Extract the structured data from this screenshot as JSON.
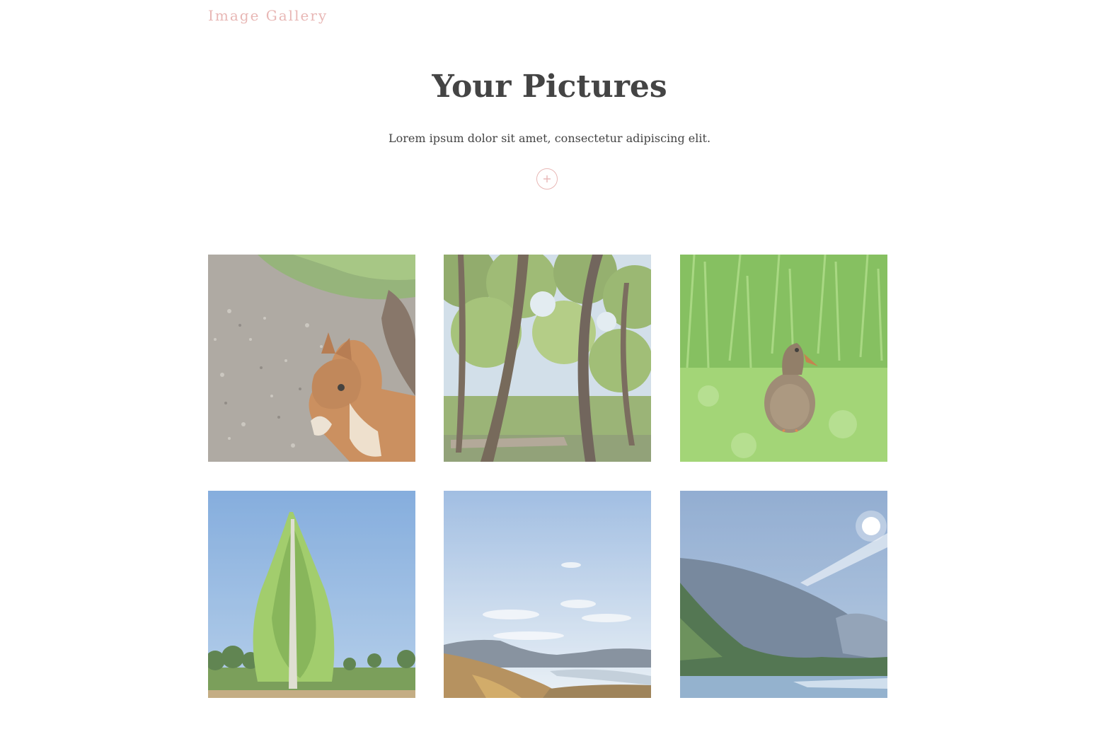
{
  "header": {
    "brand": "Image Gallery"
  },
  "hero": {
    "title": "Your Pictures",
    "subtitle": "Lorem ipsum dolor sit amet, consectetur adipiscing elit.",
    "add_icon": "plus-icon"
  },
  "gallery": {
    "items": [
      {
        "subject": "squirrel"
      },
      {
        "subject": "forest"
      },
      {
        "subject": "duck"
      },
      {
        "subject": "birch-tree"
      },
      {
        "subject": "mountain-sky"
      },
      {
        "subject": "mountain-lake"
      }
    ]
  },
  "colors": {
    "accent": "#e8b7b5",
    "text": "#444444",
    "background": "#ffffff"
  }
}
